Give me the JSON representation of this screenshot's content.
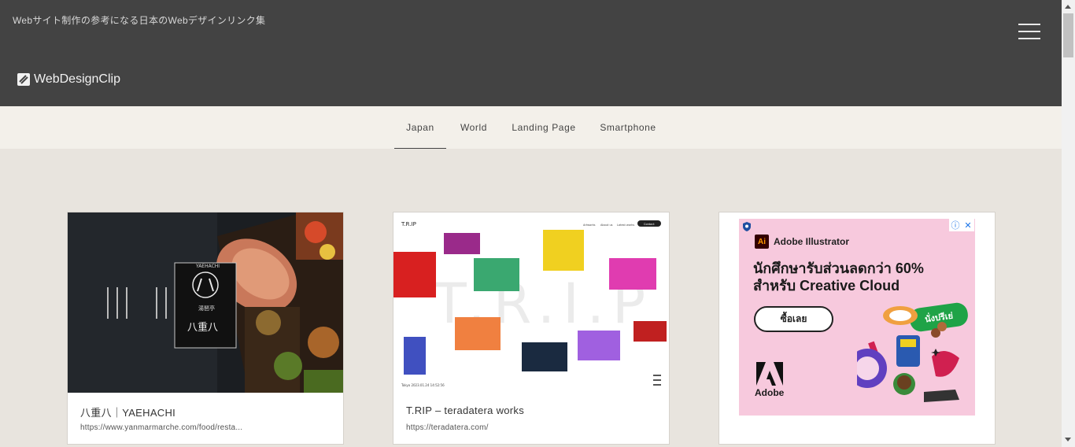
{
  "header": {
    "tagline": "Webサイト制作の参考になる日本のWebデザインリンク集",
    "logo_text": "WebDesignClip"
  },
  "nav": {
    "tabs": [
      {
        "label": "Japan",
        "active": true
      },
      {
        "label": "World",
        "active": false
      },
      {
        "label": "Landing Page",
        "active": false
      },
      {
        "label": "Smartphone",
        "active": false
      }
    ]
  },
  "cards": [
    {
      "title": "八重八｜YAEHACHI",
      "url": "https://www.yanmarmarche.com/food/resta..."
    },
    {
      "title": "T.RIP – teradatera works",
      "url": "https://teradatera.com/"
    }
  ],
  "thumb1": {
    "sign_top": "YAEHACHI",
    "sign_mid": "湯琶亭",
    "sign_bottom": "八重八"
  },
  "thumb2": {
    "logo": "T.R.IP",
    "nav": [
      "Artworks",
      "About us",
      "Latest works"
    ],
    "contact": "Contact",
    "bg_text": "T.R.I.P",
    "timestamp": "Tokyo 2023.01.24 14:52:56"
  },
  "ad": {
    "brand": "Adobe Illustrator",
    "headline": "นักศึกษารับส่วนลดกว่า 60% สำหรับ Creative Cloud",
    "cta": "ซื้อเลย",
    "badge": "นั่งปรีเย่",
    "adobe_label": "Adobe",
    "colors": {
      "bg": "#f7c9dd",
      "green": "#1fa347"
    }
  }
}
